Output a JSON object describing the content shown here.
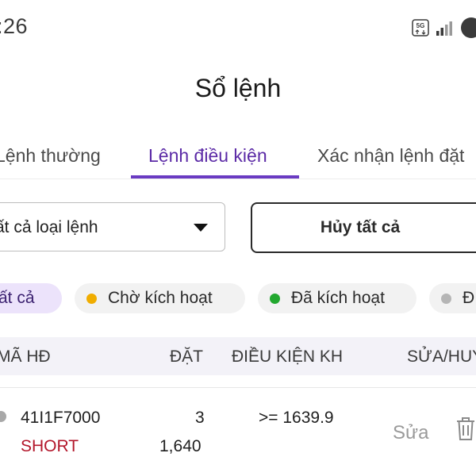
{
  "status_bar": {
    "time": ":26",
    "network": "5G"
  },
  "title": "Sổ lệnh",
  "tabs": [
    {
      "label": "Lệnh thường"
    },
    {
      "label": "Lệnh điều kiện",
      "active": true
    },
    {
      "label": "Xác nhận lệnh đặt"
    }
  ],
  "filter": {
    "order_type_value": "ất cả loại lệnh",
    "cancel_all_label": "Hủy tất cả"
  },
  "chips": [
    {
      "label": "ất cả",
      "selected": true
    },
    {
      "label": "Chờ kích hoạt",
      "dot_color": "#f0ad00"
    },
    {
      "label": "Đã kích hoạt",
      "dot_color": "#22a82f"
    },
    {
      "label": "Đ",
      "dot_color": "#b5b5b5"
    }
  ],
  "table": {
    "headers": [
      "MÃ HĐ",
      "ĐẶT",
      "ĐIỀU KIỆN KH",
      "SỬA/HUỶ"
    ],
    "rows": [
      {
        "contract": "41I1F7000",
        "side": "SHORT",
        "quantity": "3",
        "price": "1,640",
        "condition": ">= 1639.9",
        "edit_label": "Sửa"
      }
    ]
  },
  "colors": {
    "accent": "#6a3bc2",
    "short": "#b3172b",
    "pending_dot": "#f0ad00",
    "activated_dot": "#22a82f"
  }
}
